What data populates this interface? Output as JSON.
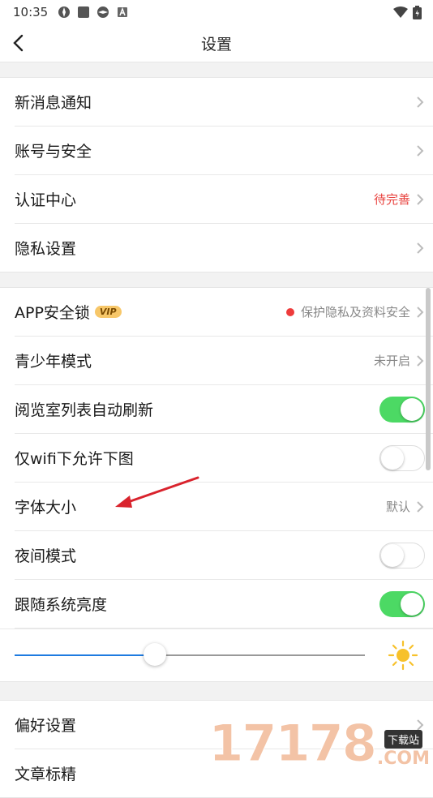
{
  "status": {
    "time": "10:35"
  },
  "nav": {
    "title": "设置"
  },
  "groups": [
    {
      "items": [
        {
          "label": "新消息通知"
        },
        {
          "label": "账号与安全"
        },
        {
          "label": "认证中心",
          "value": "待完善"
        },
        {
          "label": "隐私设置"
        }
      ]
    },
    {
      "items": [
        {
          "label": "APP安全锁",
          "badge": "VIP",
          "value": "保护隐私及资料安全"
        },
        {
          "label": "青少年模式",
          "value": "未开启"
        },
        {
          "label": "阅览室列表自动刷新",
          "toggle": true
        },
        {
          "label": "仅wifi下允许下图",
          "toggle": false
        },
        {
          "label": "字体大小",
          "value": "默认"
        },
        {
          "label": "夜间模式",
          "toggle": false
        },
        {
          "label": "跟随系统亮度",
          "toggle": true
        }
      ]
    },
    {
      "items": [
        {
          "label": "偏好设置"
        },
        {
          "label": "文章标精"
        }
      ]
    }
  ],
  "brightness": {
    "level": 0.4
  },
  "colors": {
    "toggle_on": "#4cd964",
    "alert": "#e8413d",
    "slider_fill": "#1e7be0",
    "vip_badge": "#f7c769"
  },
  "icons": [
    "back-arrow-icon",
    "chevron-right-icon",
    "sun-icon",
    "wifi-icon",
    "battery-icon"
  ],
  "watermark": {
    "number": "17178",
    "badge": "下载站",
    "suffix": ".COM"
  }
}
